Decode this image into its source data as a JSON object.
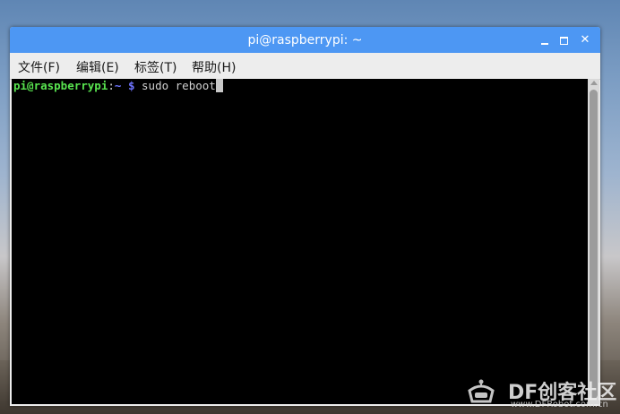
{
  "window": {
    "title": "pi@raspberrypi: ~",
    "minimize_symbol": "",
    "maximize_symbol": "",
    "close_symbol": "✕"
  },
  "menu": {
    "items": [
      "文件(F)",
      "编辑(E)",
      "标签(T)",
      "帮助(H)"
    ]
  },
  "terminal": {
    "prompt_user": "pi@raspberrypi",
    "prompt_colon": ":",
    "prompt_path": "~",
    "prompt_dollar": "$",
    "command": "sudo reboot"
  },
  "watermark": {
    "text": "DF创客社区",
    "sub": "www.DFRobot.com.cn"
  },
  "colors": {
    "titlebar": "#4d97f3",
    "terminal_bg": "#000000",
    "prompt_user": "#58e34f",
    "prompt_path": "#6f74ff"
  },
  "icons": [
    "minimize-icon",
    "maximize-icon",
    "close-icon",
    "dfrobot-logo"
  ]
}
